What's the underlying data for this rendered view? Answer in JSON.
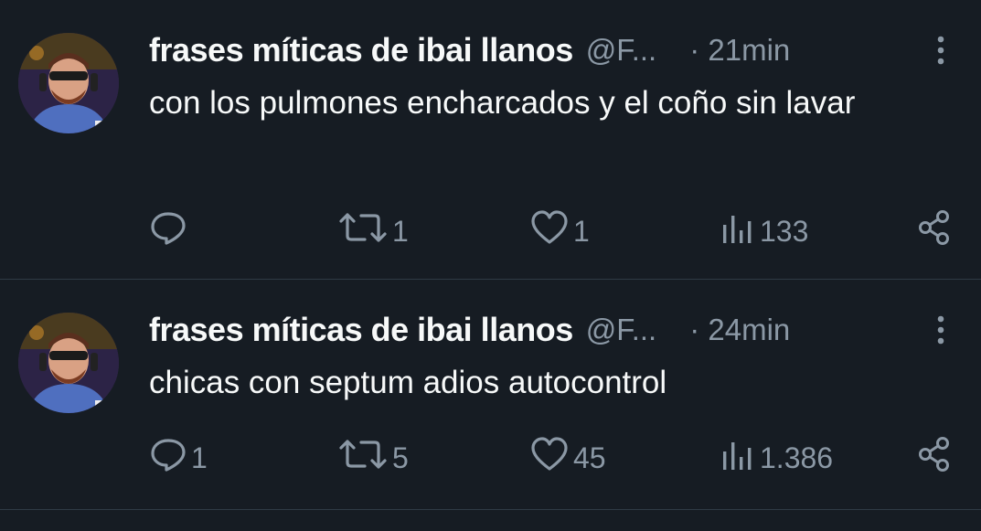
{
  "tweets": [
    {
      "name": "frases míticas de ibai llanos",
      "handle": "@F...",
      "time": "· 21min",
      "text": "con los pulmones encharcados y el coño sin lavar",
      "actions": {
        "replies": "",
        "retweets": "1",
        "likes": "1",
        "views": "133"
      }
    },
    {
      "name": "frases míticas de ibai llanos",
      "handle": "@F...",
      "time": "· 24min",
      "text": "chicas con septum adios autocontrol",
      "actions": {
        "replies": "1",
        "retweets": "5",
        "likes": "45",
        "views": "1.386"
      }
    }
  ],
  "colors": {
    "background": "#161c23",
    "text_primary": "#f7f9f9",
    "text_secondary": "#8b98a5",
    "divider": "#2f3a45"
  },
  "icons": {
    "avatar": "profile-photo",
    "more": "more-vertical-icon",
    "reply": "reply-icon",
    "retweet": "retweet-icon",
    "like": "heart-icon",
    "views": "views-chart-icon",
    "share": "share-icon"
  }
}
